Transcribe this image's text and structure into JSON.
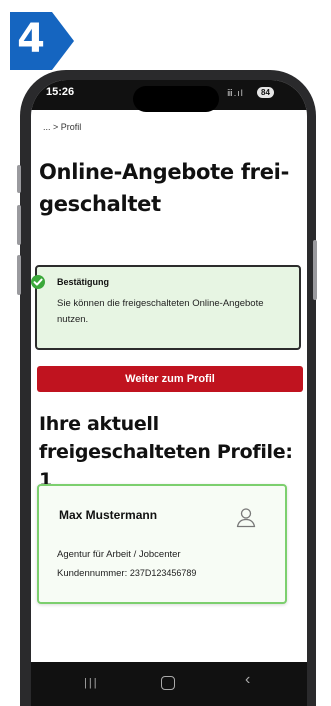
{
  "step": {
    "number": "4",
    "color": "#1565c0"
  },
  "status": {
    "time": "15:26",
    "signal": "ⅲ.ıl",
    "battery": "84"
  },
  "breadcrumb": "... > Profil",
  "page": {
    "title": "Online-Angebote frei-geschaltet"
  },
  "confirmation": {
    "title": "Bestätigung",
    "text": "Sie können die freigeschalteten Online-Angebote nutzen.",
    "icon": "check-circle-icon",
    "color": "#e7f5e3"
  },
  "cta": {
    "label": "Weiter zum Profil",
    "color": "#c0131f"
  },
  "profiles": {
    "heading": "Ihre aktuell freigeschalteten Profile: 1",
    "card": {
      "name": "Max Mustermann",
      "agency": "Agentur für Arbeit / Jobcenter",
      "customer_label": "Kundennummer:",
      "customer_number": "237D123456789",
      "icon": "user-icon",
      "border_color": "#7ccf6e"
    }
  },
  "navbar": {
    "recent": "|||",
    "back": "‹"
  }
}
